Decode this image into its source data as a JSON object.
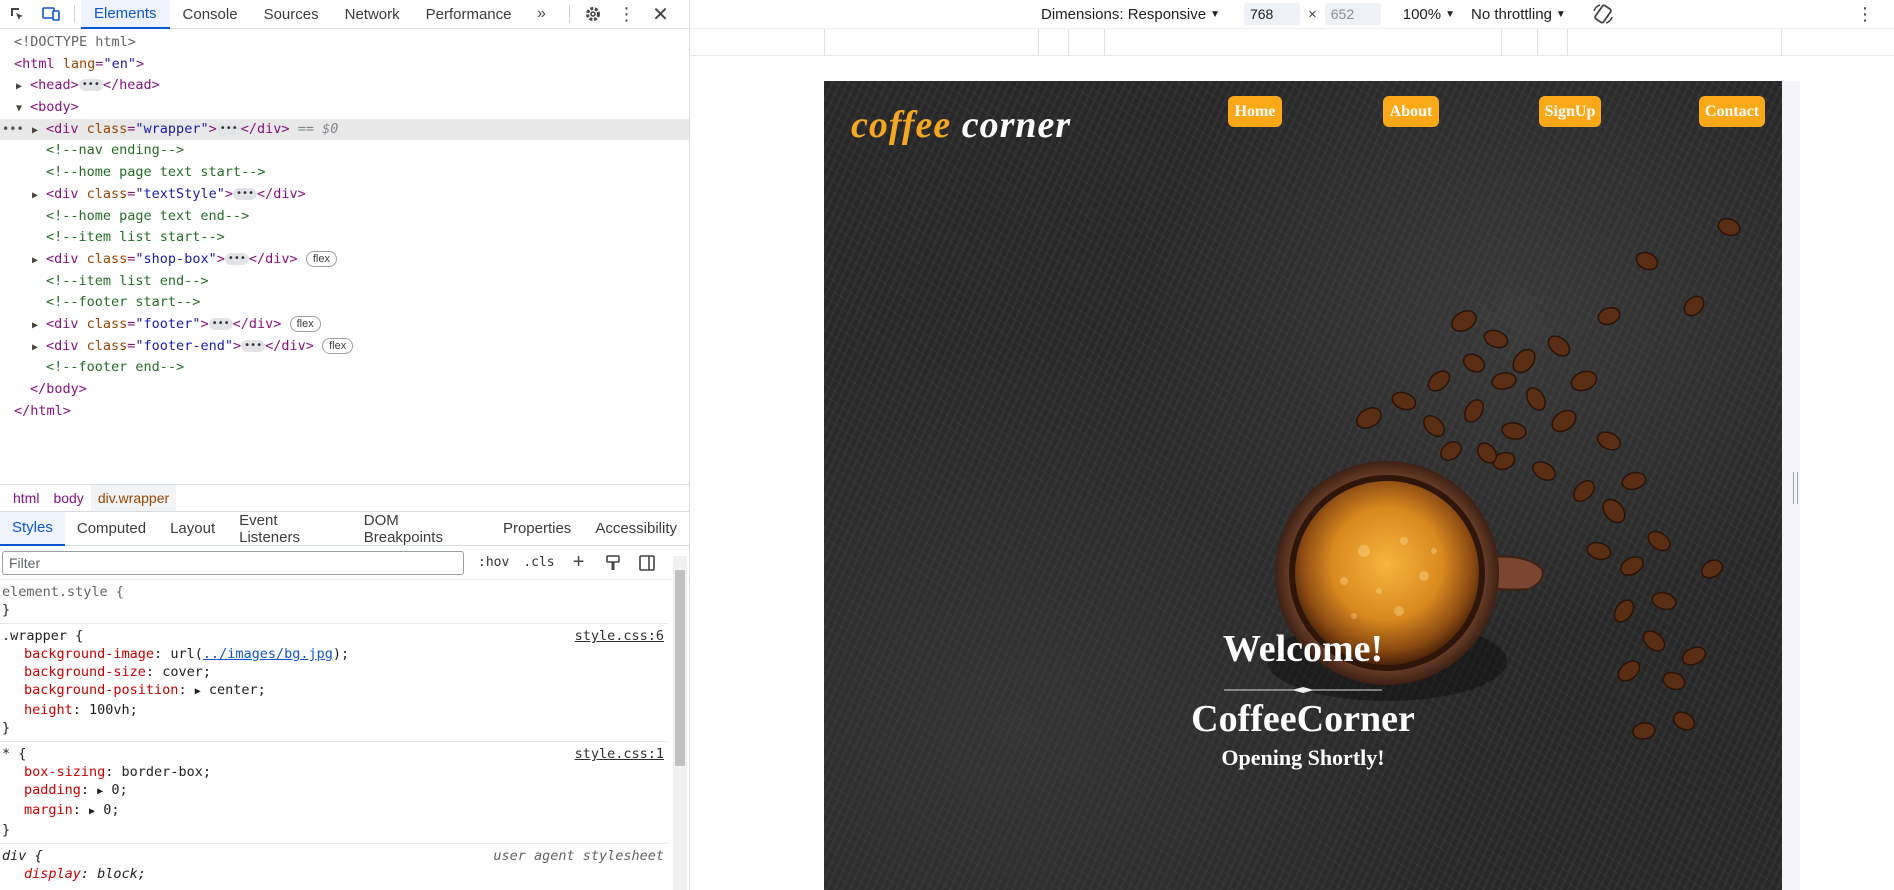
{
  "devtools": {
    "tabs": [
      "Elements",
      "Console",
      "Sources",
      "Network",
      "Performance"
    ],
    "active_tab": "Elements",
    "dom": {
      "doctype": "<!DOCTYPE html>",
      "html_open": "<html ",
      "html_attr": "lang",
      "html_attr_val": "\"en\"",
      "html_close_bracket": ">",
      "head": "<head>",
      "head_end": "</head>",
      "body": "<body>",
      "div_open": "<div ",
      "class_attr": "class",
      "wrapper_val": "\"wrapper\"",
      "textstyle_val": "\"textStyle\"",
      "shopbox_val": "\"shop-box\"",
      "footer_val": "\"footer\"",
      "footerend_val": "\"footer-end\"",
      "gt": ">",
      "div_end": "</div>",
      "eq0": "== $0",
      "flex": "flex",
      "c_nav_end": "<!--nav ending-->",
      "c_home_start": "<!--home page text start-->",
      "c_home_end": "<!--home page text end-->",
      "c_item_start": "<!--item list start-->",
      "c_item_end": "<!--item list end-->",
      "c_footer_start": "<!--footer start-->",
      "c_footer_end": "<!--footer end-->",
      "body_end": "</body>",
      "html_end": "</html>"
    },
    "breadcrumbs": [
      "html",
      "body",
      "div.wrapper"
    ],
    "style_tabs": [
      "Styles",
      "Computed",
      "Layout",
      "Event Listeners",
      "DOM Breakpoints",
      "Properties",
      "Accessibility"
    ],
    "filter_placeholder": "Filter",
    "hov": ":hov",
    "cls": ".cls",
    "rules": {
      "element_style": "element.style {",
      "close": "}",
      "wrapper_sel": ".wrapper {",
      "wrapper_src": "style.css:6",
      "bg_image_name": "background-image",
      "bg_image_pre": "url(",
      "bg_image_link": "../images/bg.jpg",
      "bg_image_post": ");",
      "bg_size_name": "background-size",
      "bg_size_val": "cover;",
      "bg_pos_name": "background-position",
      "bg_pos_val": "center;",
      "height_name": "height",
      "height_val": "100vh;",
      "star_sel": "* {",
      "star_src": "style.css:1",
      "box_name": "box-sizing",
      "box_val": "border-box;",
      "padding_name": "padding",
      "padding_val": "0;",
      "margin_name": "margin",
      "margin_val": "0;",
      "div_sel": "div {",
      "div_src": "user agent stylesheet",
      "display_name": "display",
      "display_val": "block;"
    }
  },
  "device_toolbar": {
    "dimensions_label": "Dimensions: Responsive",
    "width": "768",
    "height": "652",
    "x": "×",
    "zoom": "100%",
    "throttling": "No throttling"
  },
  "site": {
    "logo_part1": "coffee",
    "logo_part2": "corner",
    "nav": [
      "Home",
      "About",
      "SignUp",
      "Contact"
    ],
    "welcome": "Welcome!",
    "brand": "CoffeeCorner",
    "subtitle": "Opening Shortly!",
    "accent_color": "#f9a818"
  }
}
